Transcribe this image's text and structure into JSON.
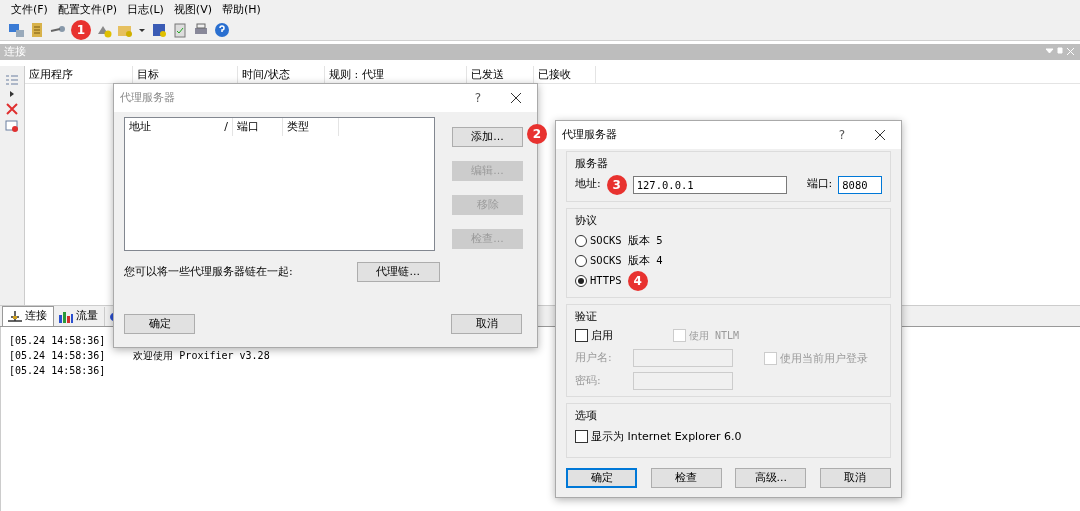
{
  "menu": [
    "文件(F)",
    "配置文件(P)",
    "日志(L)",
    "视图(V)",
    "帮助(H)"
  ],
  "panel": {
    "title": "连接"
  },
  "columns": [
    "应用程序",
    "目标",
    "时间/状态",
    "规则 : 代理",
    "已发送",
    "已接收"
  ],
  "bottom_tabs": [
    {
      "label": "连接",
      "selected": true
    },
    {
      "label": "流量",
      "selected": false
    },
    {
      "selected": false
    }
  ],
  "log": [
    {
      "time": "[05.24 14:58:36]"
    },
    {
      "time": "[05.24 14:58:36]",
      "message": "欢迎使用 Proxifier v3.28"
    },
    {
      "time": "[05.24 14:58:36]"
    }
  ],
  "proxy_list_dialog": {
    "title": "代理服务器",
    "help": "?",
    "columns": [
      "地址",
      "端口",
      "类型"
    ],
    "sort_mark": "/",
    "side_buttons": [
      {
        "label": "添加...",
        "disabled": false
      },
      {
        "label": "编辑...",
        "disabled": true
      },
      {
        "label": "移除",
        "disabled": true
      },
      {
        "label": "检查...",
        "disabled": true
      }
    ],
    "chain_text": "您可以将一些代理服务器链在一起:",
    "chain_button": "代理链...",
    "ok": "确定",
    "cancel": "取消"
  },
  "proxy_dialog": {
    "title": "代理服务器",
    "help": "?",
    "server": {
      "title": "服务器",
      "address_label": "地址:",
      "address": "127.0.0.1",
      "port_label": "端口:",
      "port": "8080"
    },
    "protocol": {
      "title": "协议",
      "options": [
        {
          "label": "SOCKS 版本 5",
          "selected": false
        },
        {
          "label": "SOCKS 版本 4",
          "selected": false
        },
        {
          "label": "HTTPS",
          "selected": true
        }
      ]
    },
    "auth": {
      "title": "验证",
      "enable": {
        "label": "启用",
        "checked": false,
        "disabled": false
      },
      "ntlm": {
        "label": "使用 NTLM",
        "checked": false,
        "disabled": true
      },
      "username_label": "用户名:",
      "password_label": "密码:",
      "current_user": {
        "label": "使用当前用户登录",
        "checked": false,
        "disabled": true
      }
    },
    "options": {
      "title": "选项",
      "ie": {
        "label": "显示为 Internet Explorer 6.0",
        "checked": false,
        "disabled": false
      }
    },
    "buttons": [
      {
        "label": "确定",
        "default": true
      },
      {
        "label": "检查",
        "default": false
      },
      {
        "label": "高级...",
        "default": false
      },
      {
        "label": "取消",
        "default": false
      }
    ]
  },
  "annotations": [
    "1",
    "2",
    "3",
    "4"
  ]
}
